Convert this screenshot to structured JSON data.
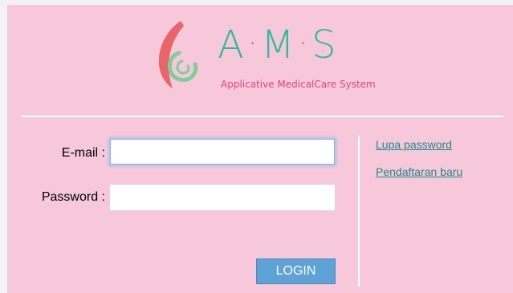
{
  "logo": {
    "letters": [
      "A",
      "M",
      "S"
    ],
    "separator": "·",
    "subtitle": "Applicative MedicalCare System"
  },
  "form": {
    "email_label": "E-mail :",
    "email_value": "",
    "password_label": "Password :",
    "password_value": "",
    "login_label": "LOGIN"
  },
  "links": {
    "forgot_password": "Lupa password",
    "register": "Pendaftaran baru"
  },
  "colors": {
    "background": "#f6c8da",
    "logo_teal": "#2ebba0",
    "logo_pink": "#e8457a",
    "button": "#5ea2d6",
    "link": "#1a8c8a"
  }
}
